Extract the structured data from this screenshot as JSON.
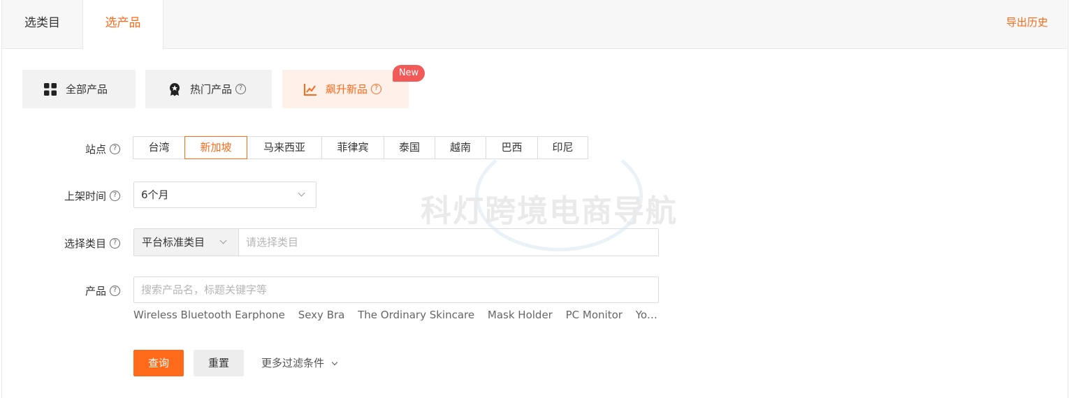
{
  "tabs": [
    {
      "label": "选类目",
      "active": false
    },
    {
      "label": "选产品",
      "active": true
    }
  ],
  "export_history": "导出历史",
  "modes": {
    "all": "全部产品",
    "hot": "热门产品",
    "rising": "飙升新品",
    "rising_badge": "New"
  },
  "form": {
    "site_label": "站点",
    "time_label": "上架时间",
    "category_label": "选择类目",
    "product_label": "产品",
    "help_glyph": "?",
    "sites": [
      "台湾",
      "新加坡",
      "马来西亚",
      "菲律宾",
      "泰国",
      "越南",
      "巴西",
      "印尼"
    ],
    "selected_site": "新加坡",
    "time_value": "6个月",
    "category_type": "平台标准类目",
    "category_placeholder": "请选择类目",
    "product_placeholder": "搜索产品名，标题关键字等",
    "suggestions": [
      "Wireless Bluetooth Earphone",
      "Sexy Bra",
      "The Ordinary Skincare",
      "Mask Holder",
      "PC Monitor",
      "Yo..."
    ]
  },
  "buttons": {
    "query": "查询",
    "reset": "重置",
    "more_filters": "更多过滤条件"
  },
  "watermark": "科灯跨境电商导航",
  "colors": {
    "accent": "#ff6a1a",
    "badge": "#f25a5a",
    "button_bg": "#f2f2f2",
    "rising_bg": "#fff0ea"
  }
}
